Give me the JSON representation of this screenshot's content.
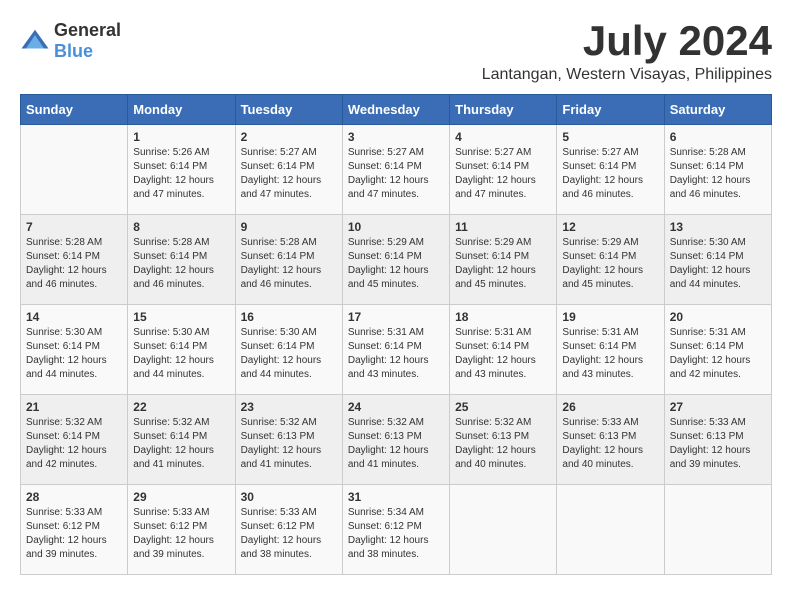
{
  "logo": {
    "general": "General",
    "blue": "Blue"
  },
  "title": "July 2024",
  "location": "Lantangan, Western Visayas, Philippines",
  "days_header": [
    "Sunday",
    "Monday",
    "Tuesday",
    "Wednesday",
    "Thursday",
    "Friday",
    "Saturday"
  ],
  "weeks": [
    [
      {
        "day": "",
        "sunrise": "",
        "sunset": "",
        "daylight": ""
      },
      {
        "day": "1",
        "sunrise": "Sunrise: 5:26 AM",
        "sunset": "Sunset: 6:14 PM",
        "daylight": "Daylight: 12 hours and 47 minutes."
      },
      {
        "day": "2",
        "sunrise": "Sunrise: 5:27 AM",
        "sunset": "Sunset: 6:14 PM",
        "daylight": "Daylight: 12 hours and 47 minutes."
      },
      {
        "day": "3",
        "sunrise": "Sunrise: 5:27 AM",
        "sunset": "Sunset: 6:14 PM",
        "daylight": "Daylight: 12 hours and 47 minutes."
      },
      {
        "day": "4",
        "sunrise": "Sunrise: 5:27 AM",
        "sunset": "Sunset: 6:14 PM",
        "daylight": "Daylight: 12 hours and 47 minutes."
      },
      {
        "day": "5",
        "sunrise": "Sunrise: 5:27 AM",
        "sunset": "Sunset: 6:14 PM",
        "daylight": "Daylight: 12 hours and 46 minutes."
      },
      {
        "day": "6",
        "sunrise": "Sunrise: 5:28 AM",
        "sunset": "Sunset: 6:14 PM",
        "daylight": "Daylight: 12 hours and 46 minutes."
      }
    ],
    [
      {
        "day": "7",
        "sunrise": "Sunrise: 5:28 AM",
        "sunset": "Sunset: 6:14 PM",
        "daylight": "Daylight: 12 hours and 46 minutes."
      },
      {
        "day": "8",
        "sunrise": "Sunrise: 5:28 AM",
        "sunset": "Sunset: 6:14 PM",
        "daylight": "Daylight: 12 hours and 46 minutes."
      },
      {
        "day": "9",
        "sunrise": "Sunrise: 5:28 AM",
        "sunset": "Sunset: 6:14 PM",
        "daylight": "Daylight: 12 hours and 46 minutes."
      },
      {
        "day": "10",
        "sunrise": "Sunrise: 5:29 AM",
        "sunset": "Sunset: 6:14 PM",
        "daylight": "Daylight: 12 hours and 45 minutes."
      },
      {
        "day": "11",
        "sunrise": "Sunrise: 5:29 AM",
        "sunset": "Sunset: 6:14 PM",
        "daylight": "Daylight: 12 hours and 45 minutes."
      },
      {
        "day": "12",
        "sunrise": "Sunrise: 5:29 AM",
        "sunset": "Sunset: 6:14 PM",
        "daylight": "Daylight: 12 hours and 45 minutes."
      },
      {
        "day": "13",
        "sunrise": "Sunrise: 5:30 AM",
        "sunset": "Sunset: 6:14 PM",
        "daylight": "Daylight: 12 hours and 44 minutes."
      }
    ],
    [
      {
        "day": "14",
        "sunrise": "Sunrise: 5:30 AM",
        "sunset": "Sunset: 6:14 PM",
        "daylight": "Daylight: 12 hours and 44 minutes."
      },
      {
        "day": "15",
        "sunrise": "Sunrise: 5:30 AM",
        "sunset": "Sunset: 6:14 PM",
        "daylight": "Daylight: 12 hours and 44 minutes."
      },
      {
        "day": "16",
        "sunrise": "Sunrise: 5:30 AM",
        "sunset": "Sunset: 6:14 PM",
        "daylight": "Daylight: 12 hours and 44 minutes."
      },
      {
        "day": "17",
        "sunrise": "Sunrise: 5:31 AM",
        "sunset": "Sunset: 6:14 PM",
        "daylight": "Daylight: 12 hours and 43 minutes."
      },
      {
        "day": "18",
        "sunrise": "Sunrise: 5:31 AM",
        "sunset": "Sunset: 6:14 PM",
        "daylight": "Daylight: 12 hours and 43 minutes."
      },
      {
        "day": "19",
        "sunrise": "Sunrise: 5:31 AM",
        "sunset": "Sunset: 6:14 PM",
        "daylight": "Daylight: 12 hours and 43 minutes."
      },
      {
        "day": "20",
        "sunrise": "Sunrise: 5:31 AM",
        "sunset": "Sunset: 6:14 PM",
        "daylight": "Daylight: 12 hours and 42 minutes."
      }
    ],
    [
      {
        "day": "21",
        "sunrise": "Sunrise: 5:32 AM",
        "sunset": "Sunset: 6:14 PM",
        "daylight": "Daylight: 12 hours and 42 minutes."
      },
      {
        "day": "22",
        "sunrise": "Sunrise: 5:32 AM",
        "sunset": "Sunset: 6:14 PM",
        "daylight": "Daylight: 12 hours and 41 minutes."
      },
      {
        "day": "23",
        "sunrise": "Sunrise: 5:32 AM",
        "sunset": "Sunset: 6:13 PM",
        "daylight": "Daylight: 12 hours and 41 minutes."
      },
      {
        "day": "24",
        "sunrise": "Sunrise: 5:32 AM",
        "sunset": "Sunset: 6:13 PM",
        "daylight": "Daylight: 12 hours and 41 minutes."
      },
      {
        "day": "25",
        "sunrise": "Sunrise: 5:32 AM",
        "sunset": "Sunset: 6:13 PM",
        "daylight": "Daylight: 12 hours and 40 minutes."
      },
      {
        "day": "26",
        "sunrise": "Sunrise: 5:33 AM",
        "sunset": "Sunset: 6:13 PM",
        "daylight": "Daylight: 12 hours and 40 minutes."
      },
      {
        "day": "27",
        "sunrise": "Sunrise: 5:33 AM",
        "sunset": "Sunset: 6:13 PM",
        "daylight": "Daylight: 12 hours and 39 minutes."
      }
    ],
    [
      {
        "day": "28",
        "sunrise": "Sunrise: 5:33 AM",
        "sunset": "Sunset: 6:12 PM",
        "daylight": "Daylight: 12 hours and 39 minutes."
      },
      {
        "day": "29",
        "sunrise": "Sunrise: 5:33 AM",
        "sunset": "Sunset: 6:12 PM",
        "daylight": "Daylight: 12 hours and 39 minutes."
      },
      {
        "day": "30",
        "sunrise": "Sunrise: 5:33 AM",
        "sunset": "Sunset: 6:12 PM",
        "daylight": "Daylight: 12 hours and 38 minutes."
      },
      {
        "day": "31",
        "sunrise": "Sunrise: 5:34 AM",
        "sunset": "Sunset: 6:12 PM",
        "daylight": "Daylight: 12 hours and 38 minutes."
      },
      {
        "day": "",
        "sunrise": "",
        "sunset": "",
        "daylight": ""
      },
      {
        "day": "",
        "sunrise": "",
        "sunset": "",
        "daylight": ""
      },
      {
        "day": "",
        "sunrise": "",
        "sunset": "",
        "daylight": ""
      }
    ]
  ]
}
